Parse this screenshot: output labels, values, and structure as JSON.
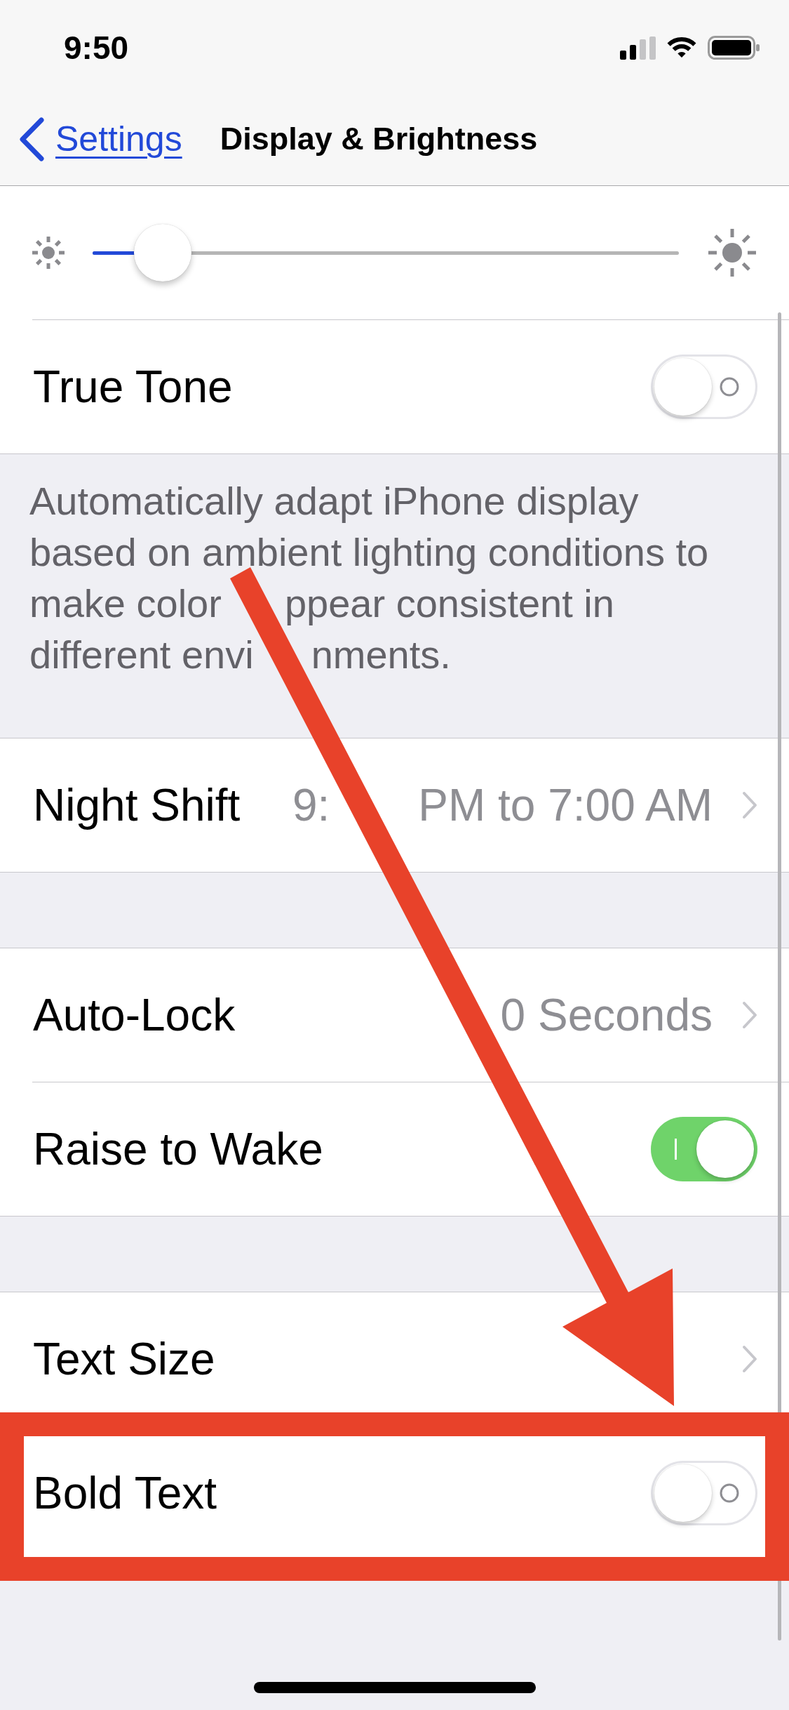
{
  "status_bar": {
    "time": "9:50"
  },
  "nav_bar": {
    "back_label": "Settings",
    "title": "Display & Brightness"
  },
  "groups": [
    {
      "rows": [
        {
          "kind": "slider",
          "level": 0.12,
          "highlighted": false
        },
        {
          "kind": "toggle",
          "label": "True Tone",
          "on": false,
          "highlighted": false
        }
      ],
      "footer": [
        "Automatically adapt iPhone display based on ambient lighting conditions to make color",
        "ppear consistent in different envi",
        "nments."
      ]
    },
    {
      "rows": [
        {
          "kind": "disclosure",
          "label": "Night Shift",
          "value": [
            "9:",
            "PM to 7:00 AM"
          ],
          "highlighted": false
        }
      ]
    },
    {
      "rows": [
        {
          "kind": "disclosure",
          "label": "Auto-Lock",
          "value": [
            "0 Seconds"
          ],
          "highlighted": false
        },
        {
          "kind": "toggle",
          "label": "Raise to Wake",
          "on": true,
          "highlighted": false
        }
      ]
    },
    {
      "rows": [
        {
          "kind": "disclosure",
          "label": "Text Size",
          "highlighted": false
        },
        {
          "kind": "toggle",
          "label": "Bold Text",
          "on": false,
          "highlighted": true
        }
      ]
    }
  ],
  "annotations": [
    {
      "kind": "arrow"
    }
  ]
}
